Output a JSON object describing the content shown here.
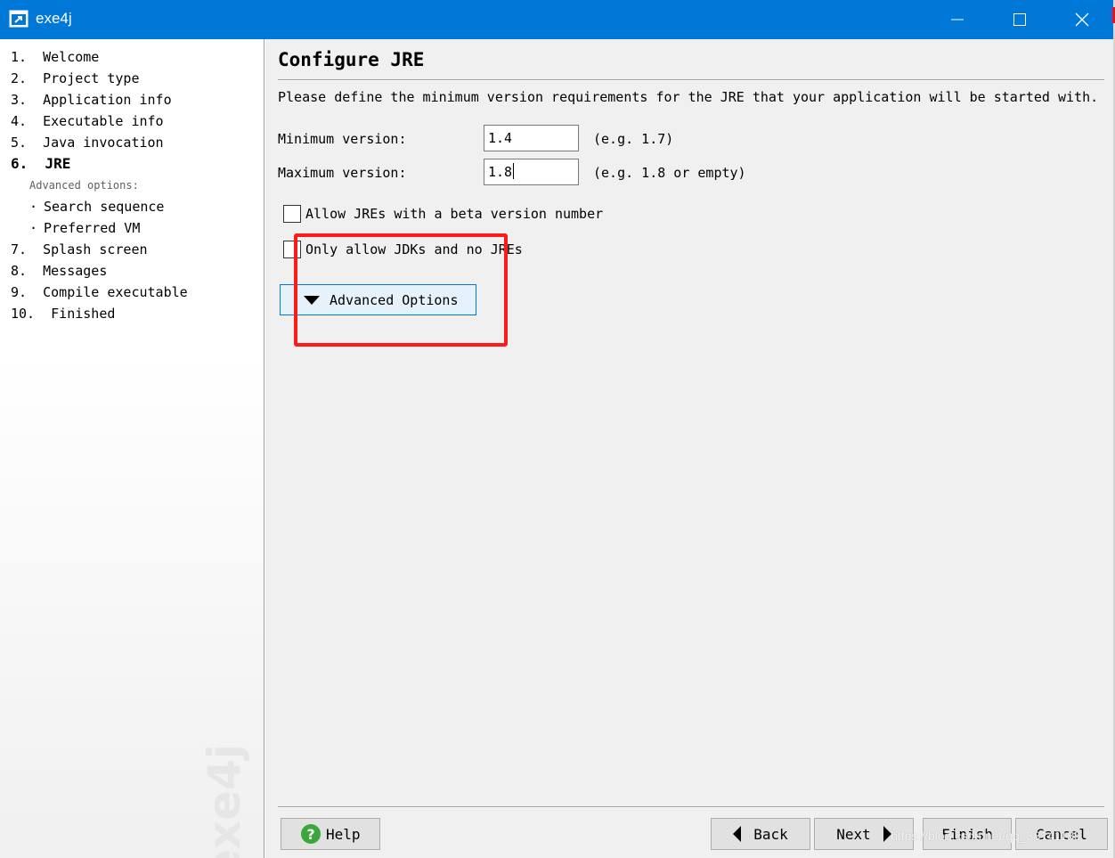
{
  "window": {
    "title": "exe4j",
    "accent_color": "#0078d7"
  },
  "sidebar": {
    "items": [
      {
        "label": "1.  Welcome"
      },
      {
        "label": "2.  Project type"
      },
      {
        "label": "3.  Application info"
      },
      {
        "label": "4.  Executable info"
      },
      {
        "label": "5.  Java invocation"
      },
      {
        "label": "6.  JRE",
        "active": true
      },
      {
        "label": "7.  Splash screen"
      },
      {
        "label": "8.  Messages"
      },
      {
        "label": "9.  Compile executable"
      },
      {
        "label": "10.  Finished"
      }
    ],
    "sub_caption": "Advanced options:",
    "sub_items": [
      {
        "label": "Search sequence"
      },
      {
        "label": "Preferred VM"
      }
    ],
    "bullet": "·",
    "watermark": "exe4j"
  },
  "main": {
    "title": "Configure JRE",
    "intro": "Please define the minimum version requirements for the JRE that your application will be started with.",
    "fields": {
      "min": {
        "label": "Minimum version:",
        "value": "1.4",
        "hint": "(e.g. 1.7)"
      },
      "max": {
        "label": "Maximum version:",
        "value": "1.8",
        "hint": "(e.g. 1.8 or empty)"
      }
    },
    "checkboxes": [
      {
        "label": "Allow JREs with a beta version number",
        "checked": false
      },
      {
        "label": "Only allow JDKs and no JREs",
        "checked": false
      }
    ],
    "advanced_button": "Advanced Options",
    "highlight_color": "#ff1a1a"
  },
  "buttons": {
    "help": "Help",
    "back": "Back",
    "next": "Next",
    "finish": "Finish",
    "cancel": "Cancel"
  },
  "icons": {
    "help": "help-icon",
    "back": "arrow-left-icon",
    "next": "arrow-right-icon",
    "advanced": "triangle-down-icon"
  },
  "credit": "https://blog.csdn.net/qq_38141185"
}
